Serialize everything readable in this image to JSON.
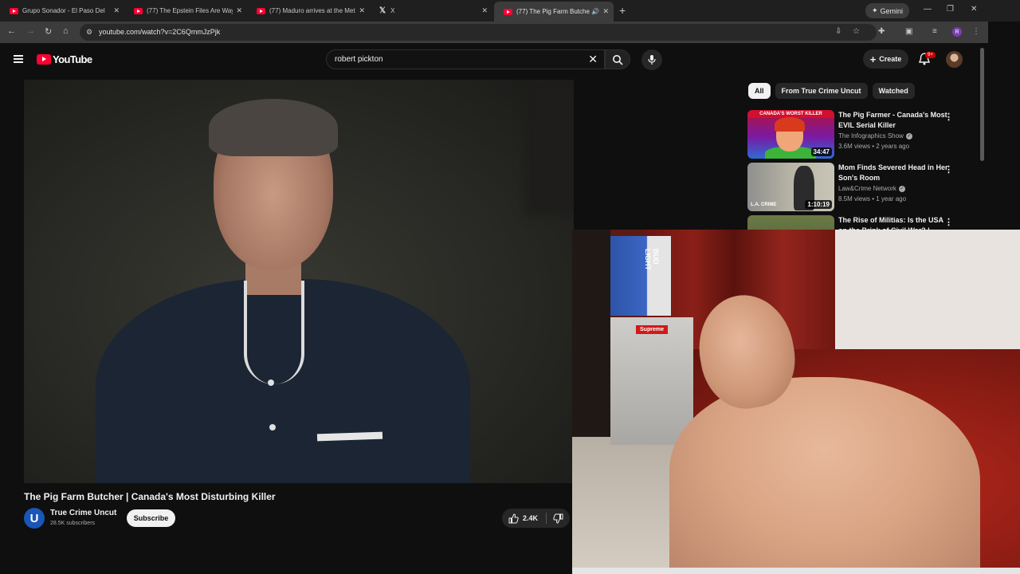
{
  "browser": {
    "tabs": [
      {
        "title": "Grupo Sonador - El Paso Del Gi",
        "favicon": "youtube-icon",
        "active": false
      },
      {
        "title": "(77) The Epstein Files Are Way",
        "favicon": "youtube-icon",
        "active": false
      },
      {
        "title": "(77) Maduro arrives at the Met",
        "favicon": "youtube-icon",
        "active": false
      },
      {
        "title": "X",
        "favicon": "x-icon",
        "active": false
      },
      {
        "title": "(77) The Pig Farm Butcher |",
        "favicon": "youtube-icon",
        "active": true
      }
    ],
    "gemini_label": "Gemini",
    "url": "youtube.com/watch?v=2C6QmmJzPjk",
    "profile_initial": "R"
  },
  "youtube": {
    "logo_text": "YouTube",
    "search_query": "robert pickton",
    "create_label": "Create",
    "notification_count": "9+"
  },
  "video": {
    "title": "The Pig Farm Butcher | Canada's Most Disturbing Killer",
    "channel": "True Crime Uncut",
    "channel_initial": "U",
    "subscribers": "28.5K subscribers",
    "subscribe_label": "Subscribe",
    "likes": "2.4K"
  },
  "chips": [
    "All",
    "From True Crime Uncut",
    "Watched"
  ],
  "recommendations": [
    {
      "title": "The Pig Farmer - Canada's Most EVIL Serial Killer",
      "channel": "The Infographics Show",
      "meta": "3.6M views • 2 years ago",
      "duration": "34:47",
      "thumb_text": "CANADA'S WORST KILLER"
    },
    {
      "title": "Mom Finds Severed Head in Her Son's Room",
      "channel": "Law&Crime Network",
      "meta": "8.5M views • 1 year ago",
      "duration": "1:10:19",
      "thumb_text": "L.A. CRIME"
    },
    {
      "title": "The Rise of Militias: Is the USA on the Brink of Civil War? |",
      "channel": "",
      "meta": "",
      "duration": ""
    }
  ],
  "webcam": {
    "box_text": "BUD LIGHT",
    "sticker_text": "Supreme"
  }
}
